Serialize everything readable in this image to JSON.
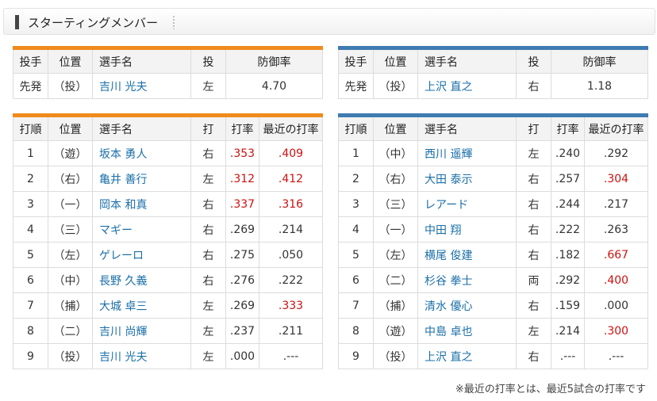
{
  "header": {
    "title": "スターティングメンバー"
  },
  "pitcher_headers": [
    "投手",
    "位置",
    "選手名",
    "投",
    "防御率"
  ],
  "batter_headers": [
    "打順",
    "位置",
    "選手名",
    "打",
    "打率",
    "最近の打率"
  ],
  "left": {
    "pitcher": {
      "role": "先発",
      "pos": "（投）",
      "name": "吉川 光夫",
      "throw": "左",
      "era": "4.70"
    },
    "batters": [
      {
        "order": "1",
        "pos": "（遊）",
        "name": "坂本 勇人",
        "bat": "右",
        "avg": ".353",
        "recent": ".409",
        "avg_hl": true,
        "recent_hl": true
      },
      {
        "order": "2",
        "pos": "（右）",
        "name": "亀井 善行",
        "bat": "左",
        "avg": ".312",
        "recent": ".412",
        "avg_hl": true,
        "recent_hl": true
      },
      {
        "order": "3",
        "pos": "（一）",
        "name": "岡本 和真",
        "bat": "右",
        "avg": ".337",
        "recent": ".316",
        "avg_hl": true,
        "recent_hl": true
      },
      {
        "order": "4",
        "pos": "（三）",
        "name": "マギー",
        "bat": "右",
        "avg": ".269",
        "recent": ".214",
        "avg_hl": false,
        "recent_hl": false
      },
      {
        "order": "5",
        "pos": "（左）",
        "name": "ゲレーロ",
        "bat": "右",
        "avg": ".275",
        "recent": ".050",
        "avg_hl": false,
        "recent_hl": false
      },
      {
        "order": "6",
        "pos": "（中）",
        "name": "長野 久義",
        "bat": "右",
        "avg": ".276",
        "recent": ".222",
        "avg_hl": false,
        "recent_hl": false
      },
      {
        "order": "7",
        "pos": "（捕）",
        "name": "大城 卓三",
        "bat": "左",
        "avg": ".269",
        "recent": ".333",
        "avg_hl": false,
        "recent_hl": true
      },
      {
        "order": "8",
        "pos": "（二）",
        "name": "吉川 尚輝",
        "bat": "左",
        "avg": ".237",
        "recent": ".211",
        "avg_hl": false,
        "recent_hl": false
      },
      {
        "order": "9",
        "pos": "（投）",
        "name": "吉川 光夫",
        "bat": "左",
        "avg": ".000",
        "recent": ".---",
        "avg_hl": false,
        "recent_hl": false
      }
    ]
  },
  "right": {
    "pitcher": {
      "role": "先発",
      "pos": "（投）",
      "name": "上沢 直之",
      "throw": "右",
      "era": "1.18"
    },
    "batters": [
      {
        "order": "1",
        "pos": "（中）",
        "name": "西川 遥輝",
        "bat": "左",
        "avg": ".240",
        "recent": ".292",
        "avg_hl": false,
        "recent_hl": false
      },
      {
        "order": "2",
        "pos": "（右）",
        "name": "大田 泰示",
        "bat": "右",
        "avg": ".257",
        "recent": ".304",
        "avg_hl": false,
        "recent_hl": true
      },
      {
        "order": "3",
        "pos": "（三）",
        "name": "レアード",
        "bat": "右",
        "avg": ".244",
        "recent": ".217",
        "avg_hl": false,
        "recent_hl": false
      },
      {
        "order": "4",
        "pos": "（一）",
        "name": "中田 翔",
        "bat": "右",
        "avg": ".222",
        "recent": ".263",
        "avg_hl": false,
        "recent_hl": false
      },
      {
        "order": "5",
        "pos": "（左）",
        "name": "横尾 俊建",
        "bat": "右",
        "avg": ".182",
        "recent": ".667",
        "avg_hl": false,
        "recent_hl": true
      },
      {
        "order": "6",
        "pos": "（二）",
        "name": "杉谷 拳士",
        "bat": "両",
        "avg": ".292",
        "recent": ".400",
        "avg_hl": false,
        "recent_hl": true
      },
      {
        "order": "7",
        "pos": "（捕）",
        "name": "清水 優心",
        "bat": "右",
        "avg": ".159",
        "recent": ".000",
        "avg_hl": false,
        "recent_hl": false
      },
      {
        "order": "8",
        "pos": "（遊）",
        "name": "中島 卓也",
        "bat": "左",
        "avg": ".214",
        "recent": ".300",
        "avg_hl": false,
        "recent_hl": true
      },
      {
        "order": "9",
        "pos": "（投）",
        "name": "上沢 直之",
        "bat": "右",
        "avg": ".---",
        "recent": ".---",
        "avg_hl": false,
        "recent_hl": false
      }
    ]
  },
  "colors": {
    "left_accent": "#f08a1c",
    "right_accent": "#3e7bb0",
    "highlight": "#cc1111",
    "link": "#1a6fa8"
  },
  "footnote": "※最近の打率とは、最近5試合の打率です"
}
